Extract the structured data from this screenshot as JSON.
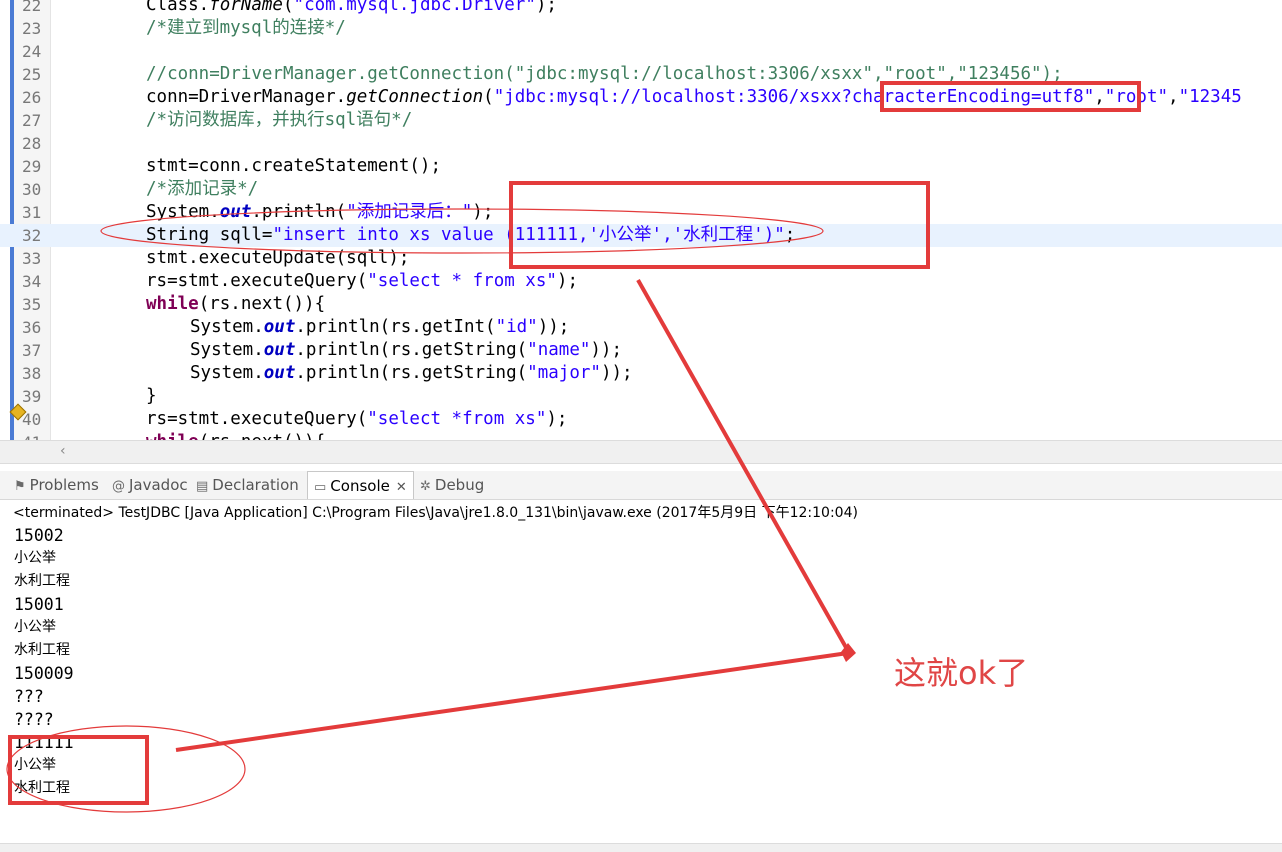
{
  "editor": {
    "lines": [
      {
        "num": "22",
        "parts": [
          [
            "",
            "Class."
          ],
          [
            "it",
            "forName"
          ],
          [
            "",
            "("
          ],
          [
            "str",
            "\"com.mysql.jdbc.Driver\""
          ],
          [
            "",
            ");"
          ]
        ]
      },
      {
        "num": "23",
        "parts": [
          [
            "cmt",
            "/*建立到mysql的连接*/"
          ]
        ]
      },
      {
        "num": "24",
        "parts": []
      },
      {
        "num": "25",
        "parts": [
          [
            "cmt",
            "//conn=DriverManager.getConnection(\"jdbc:mysql://localhost:3306/xsxx\",\"root\",\"123456\");"
          ]
        ]
      },
      {
        "num": "26",
        "parts": [
          [
            "",
            "conn=DriverManager."
          ],
          [
            "it",
            "getConnection"
          ],
          [
            "",
            "("
          ],
          [
            "str",
            "\"jdbc:mysql://localhost:3306/xsxx?characterEncoding=utf8\""
          ],
          [
            "",
            ","
          ],
          [
            "str",
            "\"root\""
          ],
          [
            "",
            ","
          ],
          [
            "str",
            "\"12345"
          ]
        ]
      },
      {
        "num": "27",
        "parts": [
          [
            "cmt",
            "/*访问数据库，并执行sql语句*/"
          ]
        ]
      },
      {
        "num": "28",
        "parts": []
      },
      {
        "num": "29",
        "parts": [
          [
            "",
            "stmt=conn.createStatement();"
          ]
        ]
      },
      {
        "num": "30",
        "parts": [
          [
            "cmt",
            "/*添加记录*/"
          ]
        ]
      },
      {
        "num": "31",
        "parts": [
          [
            "",
            "System."
          ],
          [
            "fld",
            "out"
          ],
          [
            "",
            ".println("
          ],
          [
            "str",
            "\"添加记录后：\""
          ],
          [
            "",
            ");"
          ]
        ]
      },
      {
        "num": "32",
        "current": true,
        "parts": [
          [
            "",
            "String sqll="
          ],
          [
            "str",
            "\"insert into xs value (111111,'小公举','水利工程')\""
          ],
          [
            "",
            ";"
          ]
        ]
      },
      {
        "num": "33",
        "parts": [
          [
            "",
            "stmt.executeUpdate(sqll);"
          ]
        ]
      },
      {
        "num": "34",
        "parts": [
          [
            "",
            "rs=stmt.executeQuery("
          ],
          [
            "str",
            "\"select * from xs\""
          ],
          [
            "",
            ");"
          ]
        ]
      },
      {
        "num": "35",
        "parts": [
          [
            "kw",
            "while"
          ],
          [
            "",
            "(rs.next()){"
          ]
        ]
      },
      {
        "num": "36",
        "indent": true,
        "parts": [
          [
            "",
            "System."
          ],
          [
            "fld",
            "out"
          ],
          [
            "",
            ".println(rs.getInt("
          ],
          [
            "str",
            "\"id\""
          ],
          [
            "",
            "));"
          ]
        ]
      },
      {
        "num": "37",
        "indent": true,
        "parts": [
          [
            "",
            "System."
          ],
          [
            "fld",
            "out"
          ],
          [
            "",
            ".println(rs.getString("
          ],
          [
            "str",
            "\"name\""
          ],
          [
            "",
            "));"
          ]
        ]
      },
      {
        "num": "38",
        "indent": true,
        "parts": [
          [
            "",
            "System."
          ],
          [
            "fld",
            "out"
          ],
          [
            "",
            ".println(rs.getString("
          ],
          [
            "str",
            "\"major\""
          ],
          [
            "",
            "));"
          ]
        ]
      },
      {
        "num": "39",
        "parts": [
          [
            "",
            "}"
          ]
        ]
      },
      {
        "num": "40",
        "parts": [
          [
            "",
            "rs=stmt.executeQuery("
          ],
          [
            "str",
            "\"select *from xs\""
          ],
          [
            "",
            ");"
          ]
        ]
      },
      {
        "num": "41",
        "parts": [
          [
            "kw",
            "while"
          ],
          [
            "",
            "(rs.next()){"
          ]
        ]
      }
    ]
  },
  "views": {
    "tabs": [
      {
        "label": "Problems",
        "icon": "problems-icon",
        "glyph": "⚑"
      },
      {
        "label": "Javadoc",
        "icon": "javadoc-icon",
        "glyph": "@"
      },
      {
        "label": "Declaration",
        "icon": "declaration-icon",
        "glyph": "▤"
      },
      {
        "label": "Console",
        "icon": "console-icon",
        "glyph": "▭",
        "active": true
      },
      {
        "label": "Debug",
        "icon": "debug-icon",
        "glyph": "✲"
      }
    ],
    "close_glyph": "✕"
  },
  "console": {
    "header": "<terminated> TestJDBC [Java Application] C:\\Program Files\\Java\\jre1.8.0_131\\bin\\javaw.exe (2017年5月9日 下午12:10:04)",
    "output": [
      "15002",
      "小公举",
      "水利工程",
      "15001",
      "小公举",
      "水利工程",
      "150009",
      "???",
      "????",
      "111111",
      "小公举",
      "水利工程"
    ]
  },
  "annotation": {
    "text": "这就ok了",
    "color": "#e33b3b"
  },
  "colors": {
    "keyword": "#7f0055",
    "string": "#2a00ff",
    "comment": "#3f7f5f",
    "field": "#0000c0",
    "current_line": "#e8f2fe"
  }
}
